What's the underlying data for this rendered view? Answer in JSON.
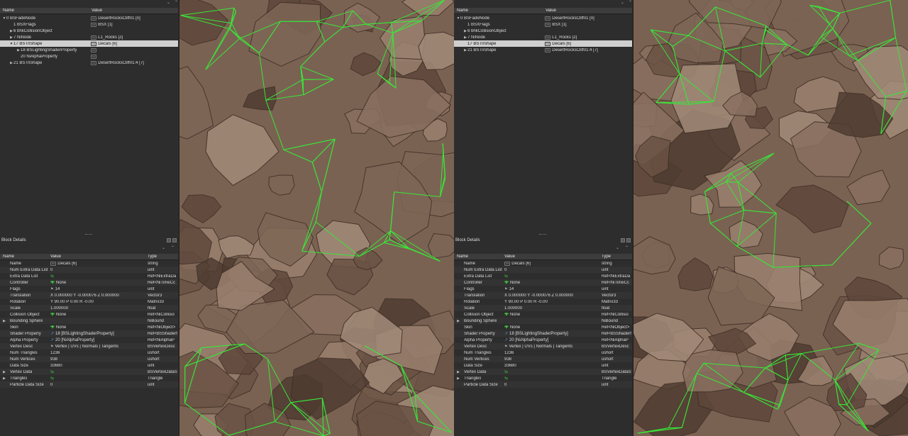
{
  "panels": [
    {
      "tree": {
        "headers": {
          "name": "Name",
          "value": "Value"
        },
        "rows": [
          {
            "indent": 0,
            "arrow": "down",
            "name": "0 BSFadeNode",
            "icon": "txt",
            "value": "DesertRocksCliff01 [0]"
          },
          {
            "indent": 1,
            "arrow": "",
            "name": "1 BSXFlags",
            "icon": "txt",
            "value": "BSX [1]"
          },
          {
            "indent": 1,
            "arrow": "right",
            "name": "6 bhkCollisionObject",
            "icon": "",
            "value": ""
          },
          {
            "indent": 1,
            "arrow": "right",
            "name": "7 NiNode",
            "icon": "txt",
            "value": "L1_Rocks [2]"
          },
          {
            "indent": 1,
            "arrow": "down",
            "name": "17 BSTriShape",
            "icon": "txt",
            "value": "Decals [6]",
            "selected": true
          },
          {
            "indent": 2,
            "arrow": "right",
            "name": "18 BSLightingShaderProperty",
            "icon": "txt",
            "value": ""
          },
          {
            "indent": 2,
            "arrow": "",
            "name": "20 NiAlphaProperty",
            "icon": "txt",
            "value": ""
          },
          {
            "indent": 1,
            "arrow": "right",
            "name": "21 BSTriShape",
            "icon": "txt",
            "value": "DesertRocksCliff01:4 [7]"
          }
        ]
      },
      "details": {
        "title": "Block Details",
        "headers": {
          "name": "Name",
          "value": "Value",
          "type": "Type"
        },
        "rows": [
          {
            "arrow": "",
            "name": "Name",
            "icon": "txt",
            "value": "Decals [6]",
            "type": "string"
          },
          {
            "arrow": "",
            "name": "Num Extra Data List",
            "icon": "",
            "value": "0",
            "type": "uint"
          },
          {
            "arrow": "",
            "name": "Extra Data List",
            "icon": "link",
            "value": "",
            "type": "Ref<NiExtraDa"
          },
          {
            "arrow": "",
            "name": "Controller",
            "icon": "plus",
            "value": "None",
            "type": "Ref<NiTimeCc"
          },
          {
            "arrow": "",
            "name": "Flags",
            "icon": "flag",
            "value": "14",
            "type": "uint"
          },
          {
            "arrow": "",
            "name": "Translation",
            "icon": "",
            "value": "X 0.000000 Y -0.000076 Z 0.000000",
            "type": "Vector3"
          },
          {
            "arrow": "",
            "name": "Rotation",
            "icon": "",
            "value": "Y 90.00 P 0.00 R -0.00",
            "type": "Matrix33"
          },
          {
            "arrow": "",
            "name": "Scale",
            "icon": "",
            "value": "1.000000",
            "type": "float"
          },
          {
            "arrow": "",
            "name": "Collision Object",
            "icon": "plus",
            "value": "None",
            "type": "Ref<NiCollisio"
          },
          {
            "arrow": "right",
            "name": "Bounding Sphere",
            "icon": "",
            "value": "",
            "type": "NiBound"
          },
          {
            "arrow": "",
            "name": "Skin",
            "icon": "plus",
            "value": "None",
            "type": "Ref<NiObject>"
          },
          {
            "arrow": "",
            "name": "Shader Property",
            "icon": "pin",
            "value": "18 [BSLightingShaderProperty]",
            "type": "Ref<BSShaderf"
          },
          {
            "arrow": "",
            "name": "Alpha Property",
            "icon": "pin",
            "value": "20 [NiAlphaProperty]",
            "type": "Ref<NiAlphaP"
          },
          {
            "arrow": "",
            "name": "Vertex Desc",
            "icon": "flag",
            "value": "Vertex | UVs | Normals | Tangents",
            "type": "BSVertexDesc"
          },
          {
            "arrow": "",
            "name": "Num Triangles",
            "icon": "",
            "value": "1236",
            "type": "ushort"
          },
          {
            "arrow": "",
            "name": "Num Vertices",
            "icon": "",
            "value": "938",
            "type": "ushort"
          },
          {
            "arrow": "",
            "name": "Data Size",
            "icon": "",
            "value": "33680",
            "type": "uint"
          },
          {
            "arrow": "right",
            "name": "Vertex Data",
            "icon": "link",
            "value": "",
            "type": "BSVertexDataS"
          },
          {
            "arrow": "right",
            "name": "Triangles",
            "icon": "link",
            "value": "",
            "type": "Triangle"
          },
          {
            "arrow": "",
            "name": "Particle Data Size",
            "icon": "",
            "value": "0",
            "type": "uint"
          }
        ]
      }
    },
    {
      "tree": {
        "headers": {
          "name": "Name",
          "value": "Value"
        },
        "rows": [
          {
            "indent": 0,
            "arrow": "down",
            "name": "0 BSFadeNode",
            "icon": "txt",
            "value": "DesertRocksCliff01 [0]"
          },
          {
            "indent": 1,
            "arrow": "",
            "name": "1 BSXFlags",
            "icon": "txt",
            "value": "BSX [1]"
          },
          {
            "indent": 1,
            "arrow": "right",
            "name": "6 bhkCollisionObject",
            "icon": "",
            "value": ""
          },
          {
            "indent": 1,
            "arrow": "right",
            "name": "7 NiNode",
            "icon": "txt",
            "value": "L1_Rocks [2]"
          },
          {
            "indent": 1,
            "arrow": "",
            "name": "17 BSTriShape",
            "icon": "txt",
            "value": "Decals [6]",
            "selected": true
          },
          {
            "indent": 1,
            "arrow": "right",
            "name": "21 BSTriShape",
            "icon": "txt",
            "value": "DesertRocksCliff01:4 [7]"
          }
        ]
      },
      "details": {
        "title": "Block Details",
        "headers": {
          "name": "Name",
          "value": "Value",
          "type": "Type"
        },
        "rows": [
          {
            "arrow": "",
            "name": "Name",
            "icon": "txt",
            "value": "Decals [6]",
            "type": "string"
          },
          {
            "arrow": "",
            "name": "Num Extra Data List",
            "icon": "",
            "value": "0",
            "type": "uint"
          },
          {
            "arrow": "",
            "name": "Extra Data List",
            "icon": "link",
            "value": "",
            "type": "Ref<NiExtraDa"
          },
          {
            "arrow": "",
            "name": "Controller",
            "icon": "plus",
            "value": "None",
            "type": "Ref<NiTimeCc"
          },
          {
            "arrow": "",
            "name": "Flags",
            "icon": "flag",
            "value": "14",
            "type": "uint"
          },
          {
            "arrow": "",
            "name": "Translation",
            "icon": "",
            "value": "X 0.000000 Y -0.000076 Z 0.000000",
            "type": "Vector3"
          },
          {
            "arrow": "",
            "name": "Rotation",
            "icon": "",
            "value": "Y 90.00 P 0.00 R -0.00",
            "type": "Matrix33"
          },
          {
            "arrow": "",
            "name": "Scale",
            "icon": "",
            "value": "1.000000",
            "type": "float"
          },
          {
            "arrow": "",
            "name": "Collision Object",
            "icon": "plus",
            "value": "None",
            "type": "Ref<NiCollisio"
          },
          {
            "arrow": "right",
            "name": "Bounding Sphere",
            "icon": "",
            "value": "",
            "type": "NiBound"
          },
          {
            "arrow": "",
            "name": "Skin",
            "icon": "plus",
            "value": "None",
            "type": "Ref<NiObject>"
          },
          {
            "arrow": "",
            "name": "Shader Property",
            "icon": "pin",
            "value": "18 [BSLightingShaderProperty]",
            "type": "Ref<BSShaderf"
          },
          {
            "arrow": "",
            "name": "Alpha Property",
            "icon": "pin",
            "value": "20 [NiAlphaProperty]",
            "type": "Ref<NiAlphaP"
          },
          {
            "arrow": "",
            "name": "Vertex Desc",
            "icon": "flag",
            "value": "Vertex | UVs | Normals | Tangents",
            "type": "BSVertexDesc"
          },
          {
            "arrow": "",
            "name": "Num Triangles",
            "icon": "",
            "value": "1236",
            "type": "ushort"
          },
          {
            "arrow": "",
            "name": "Num Vertices",
            "icon": "",
            "value": "938",
            "type": "ushort"
          },
          {
            "arrow": "",
            "name": "Data Size",
            "icon": "",
            "value": "33680",
            "type": "uint"
          },
          {
            "arrow": "right",
            "name": "Vertex Data",
            "icon": "link",
            "value": "",
            "type": "BSVertexDataS"
          },
          {
            "arrow": "right",
            "name": "Triangles",
            "icon": "link",
            "value": "",
            "type": "Triangle"
          },
          {
            "arrow": "",
            "name": "Particle Data Size",
            "icon": "",
            "value": "0",
            "type": "uint"
          }
        ]
      }
    }
  ],
  "colors": {
    "wireframe": "#39e639",
    "rock": "#7a6252",
    "selection": "#cfcfcf"
  }
}
